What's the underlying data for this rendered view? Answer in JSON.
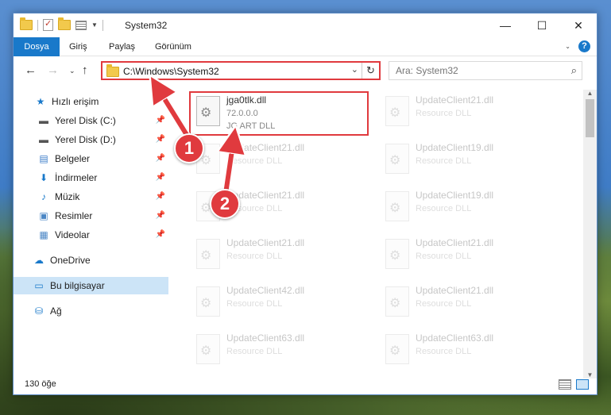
{
  "window": {
    "title": "System32",
    "caption": {
      "minimize": "—",
      "maximize": "☐",
      "close": "✕"
    }
  },
  "ribbon": {
    "tabs": [
      "Dosya",
      "Giriş",
      "Paylaş",
      "Görünüm"
    ]
  },
  "nav": {
    "address": "C:\\Windows\\System32",
    "search_placeholder": "Ara: System32"
  },
  "sidebar": {
    "items": [
      {
        "label": "Hızlı erişim",
        "icon": "star-icon",
        "pinned": false
      },
      {
        "label": "Yerel Disk (C:)",
        "icon": "drive-icon",
        "pinned": true
      },
      {
        "label": "Yerel Disk (D:)",
        "icon": "drive-icon",
        "pinned": true
      },
      {
        "label": "Belgeler",
        "icon": "documents-icon",
        "pinned": true
      },
      {
        "label": "İndirmeler",
        "icon": "downloads-icon",
        "pinned": true
      },
      {
        "label": "Müzik",
        "icon": "music-icon",
        "pinned": true
      },
      {
        "label": "Resimler",
        "icon": "pictures-icon",
        "pinned": true
      },
      {
        "label": "Videolar",
        "icon": "videos-icon",
        "pinned": true
      },
      {
        "label": "OneDrive",
        "icon": "cloud-icon",
        "pinned": false
      },
      {
        "label": "Bu bilgisayar",
        "icon": "computer-icon",
        "pinned": false,
        "selected": true
      },
      {
        "label": "Ağ",
        "icon": "network-icon",
        "pinned": false
      }
    ]
  },
  "files": {
    "highlighted": {
      "name": "jga0tlk.dll",
      "version": "72.0.0.0",
      "description": "JG ART DLL"
    },
    "left_col": [
      {
        "name": "UpdateClient21.dll",
        "description": "Resource DLL"
      },
      {
        "name": "UpdateClient21.dll",
        "description": "Resource DLL"
      },
      {
        "name": "UpdateClient21.dll",
        "description": "Resource DLL"
      },
      {
        "name": "UpdateClient42.dll",
        "description": "Resource DLL"
      },
      {
        "name": "UpdateClient63.dll",
        "description": "Resource DLL"
      }
    ],
    "right_col": [
      {
        "name": "UpdateClient21.dll",
        "description": "Resource DLL"
      },
      {
        "name": "UpdateClient19.dll",
        "description": "Resource DLL"
      },
      {
        "name": "UpdateClient19.dll",
        "description": "Resource DLL"
      },
      {
        "name": "UpdateClient21.dll",
        "description": "Resource DLL"
      },
      {
        "name": "UpdateClient21.dll",
        "description": "Resource DLL"
      },
      {
        "name": "UpdateClient63.dll",
        "description": "Resource DLL"
      }
    ]
  },
  "status": {
    "count": "130 öğe"
  },
  "annotations": {
    "step1": "1",
    "step2": "2",
    "accent_color": "#e03a3e"
  }
}
